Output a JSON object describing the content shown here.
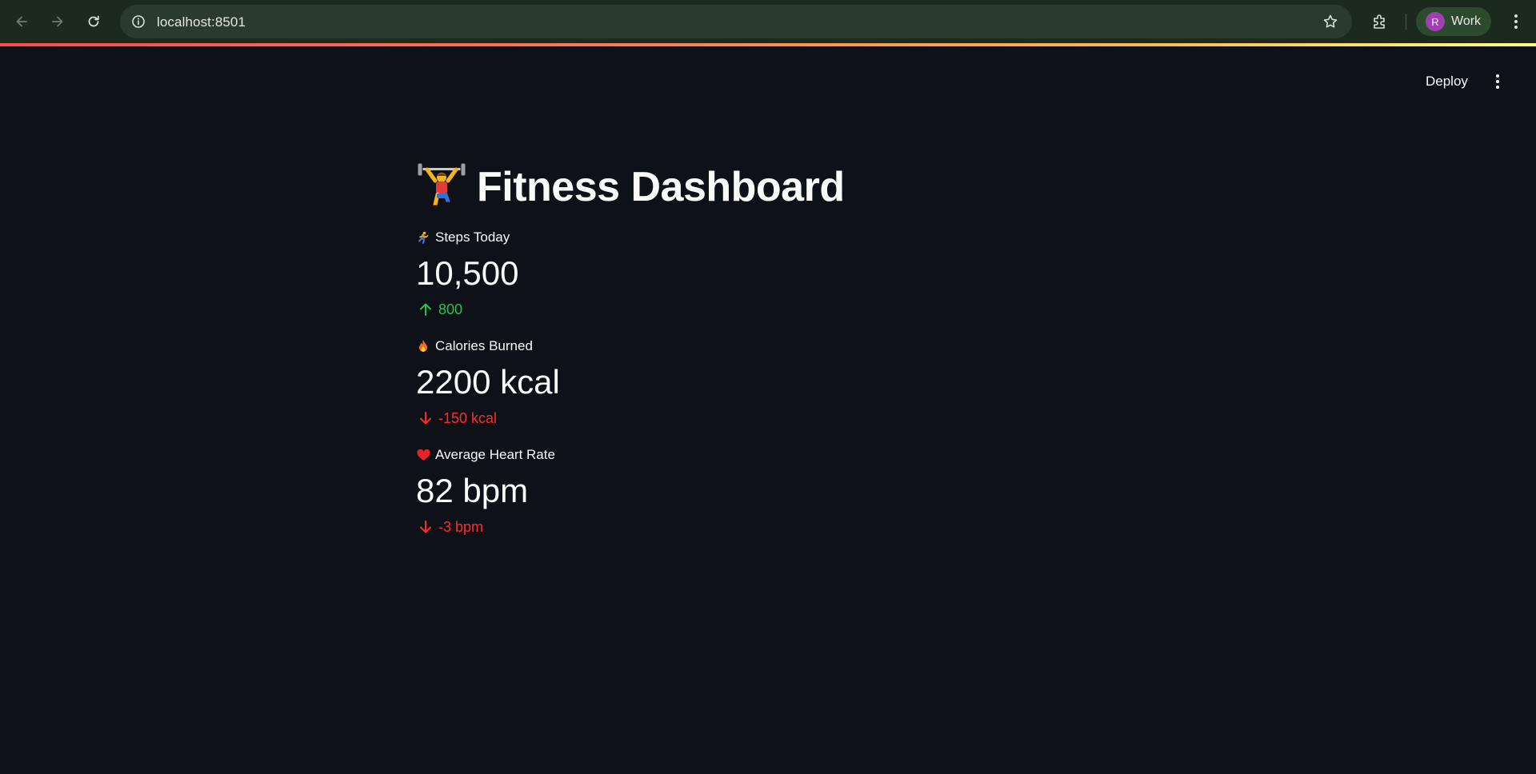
{
  "browser": {
    "url": "localhost:8501",
    "profile_initial": "R",
    "profile_name": "Work"
  },
  "app_header": {
    "deploy_label": "Deploy"
  },
  "page": {
    "title": "Fitness Dashboard",
    "title_icon": "weightlifter-emoji"
  },
  "metrics": [
    {
      "icon": "runner-emoji",
      "label": "Steps Today",
      "value": "10,500",
      "delta": "800",
      "direction": "up",
      "delta_color": "#21c354"
    },
    {
      "icon": "fire-emoji",
      "label": "Calories Burned",
      "value": "2200 kcal",
      "delta": "-150 kcal",
      "direction": "down",
      "delta_color": "#ff2b2b"
    },
    {
      "icon": "heart-emoji",
      "label": "Average Heart Rate",
      "value": "82 bpm",
      "delta": "-3 bpm",
      "direction": "down",
      "delta_color": "#ff2b2b"
    }
  ],
  "colors": {
    "background": "#0e1117",
    "text": "#fafafa",
    "browser_bar": "#1b2a1d",
    "accent_gradient_start": "#ff4b4b",
    "accent_gradient_end": "#fffd80"
  }
}
